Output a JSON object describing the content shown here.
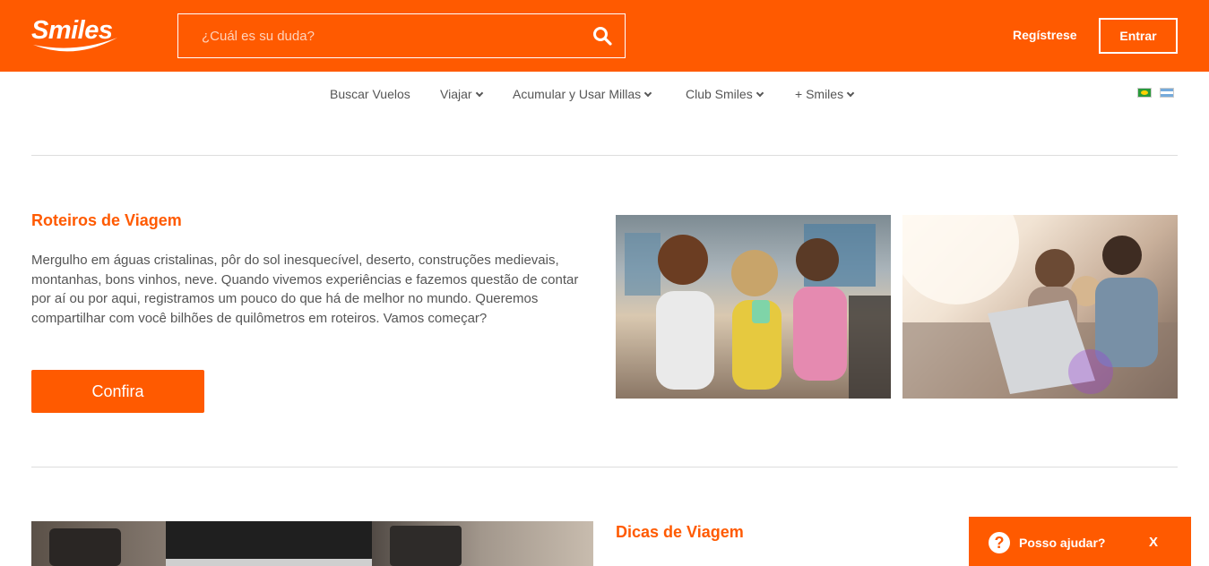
{
  "header": {
    "logo_text": "Smiles",
    "search_placeholder": "¿Cuál es su duda?",
    "register_label": "Regístrese",
    "login_label": "Entrar",
    "brand_color": "#ff5a00"
  },
  "nav": {
    "items": [
      {
        "label": "Buscar Vuelos",
        "dropdown": false
      },
      {
        "label": "Viajar",
        "dropdown": true
      },
      {
        "label": "Acumular y Usar Millas",
        "dropdown": true
      },
      {
        "label": "Club Smiles",
        "dropdown": true
      },
      {
        "label": "+ Smiles",
        "dropdown": true
      }
    ],
    "flags": [
      "brazil-flag-icon",
      "argentina-flag-icon"
    ]
  },
  "section1": {
    "title": "Roteiros de Viagem",
    "text": "Mergulho em águas cristalinas, pôr do sol inesquecível, deserto, construções medievais, montanhas, bons vinhos, neve. Quando vivemos experiências e fazemos questão de contar por aí ou por aqui, registramos um pouco do que há de melhor no mundo. Queremos compartilhar com você bilhões de quilômetros em roteiros. Vamos começar?",
    "button_label": "Confira"
  },
  "section2": {
    "title": "Dicas de Viagem"
  },
  "help_widget": {
    "label": "Posso ajudar?",
    "close_label": "X",
    "icon": "question-icon"
  }
}
